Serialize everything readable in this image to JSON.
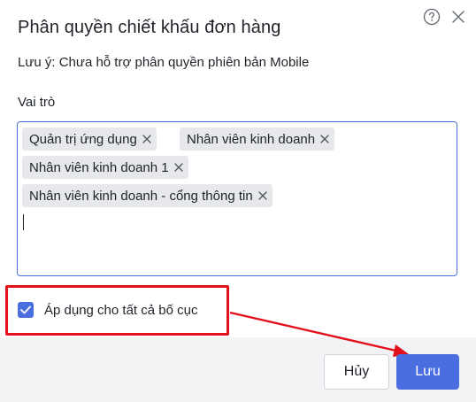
{
  "dialog": {
    "title": "Phân quyền chiết khấu đơn hàng",
    "note": "Lưu ý: Chưa hỗ trợ phân quyền phiên bản Mobile",
    "role_label": "Vai trò",
    "roles": [
      "Quản trị ứng dụng",
      "Nhân viên kinh doanh",
      "Nhân viên kinh doanh 1",
      "Nhân viên kinh doanh - cổng thông tin"
    ],
    "apply_all_label": "Áp dụng cho tất cả bố cục",
    "apply_all_checked": true,
    "cancel_label": "Hủy",
    "save_label": "Lưu"
  },
  "colors": {
    "primary": "#4a6ee0",
    "tag_bg": "#e6e8ec",
    "annotation_red": "#e3111b",
    "footer_bg": "#f2f3f5"
  },
  "icons": [
    "help-icon",
    "close-icon",
    "tag-remove-icon",
    "checkmark-icon"
  ]
}
